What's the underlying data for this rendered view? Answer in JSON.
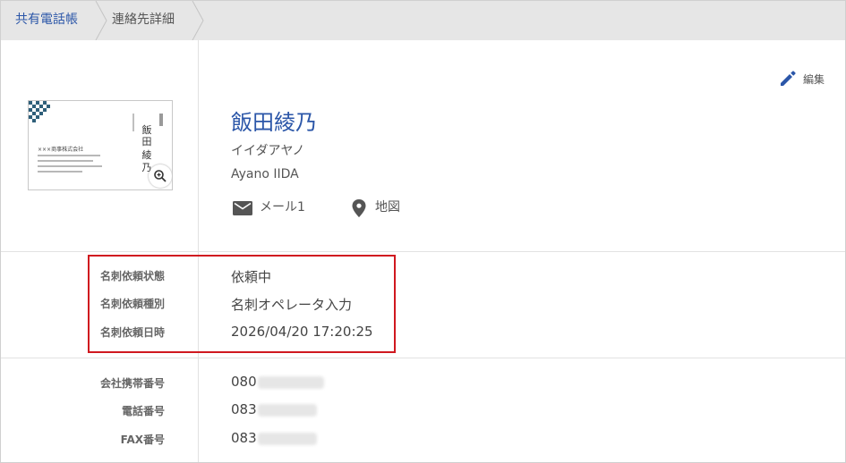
{
  "breadcrumb": {
    "items": [
      "共有電話帳",
      "連絡先詳細"
    ]
  },
  "card": {
    "company": "×××商事株式会社",
    "name_line1": "飯田",
    "name_line2": "綾乃"
  },
  "contact": {
    "name": "飯田綾乃",
    "kana": "イイダアヤノ",
    "roman": "Ayano IIDA",
    "mail_label": "メール1",
    "map_label": "地図",
    "edit_label": "編集"
  },
  "request": {
    "status_label": "名刺依頼状態",
    "status_value": "依頼中",
    "type_label": "名刺依頼種別",
    "type_value": "名刺オペレータ入力",
    "date_label": "名刺依頼日時",
    "date_value": "2026/04/20 17:20:25"
  },
  "phones": {
    "mobile_label": "会社携帯番号",
    "mobile_prefix": "080",
    "tel_label": "電話番号",
    "tel_prefix": "083",
    "fax_label": "FAX番号",
    "fax_prefix": "083"
  },
  "colors": {
    "accent": "#2b56a8",
    "highlight": "#d0181f",
    "breadcrumb_bg": "#e6e6e6"
  },
  "icons": [
    "pencil-icon",
    "mail-icon",
    "map-pin-icon",
    "zoom-in-icon"
  ]
}
